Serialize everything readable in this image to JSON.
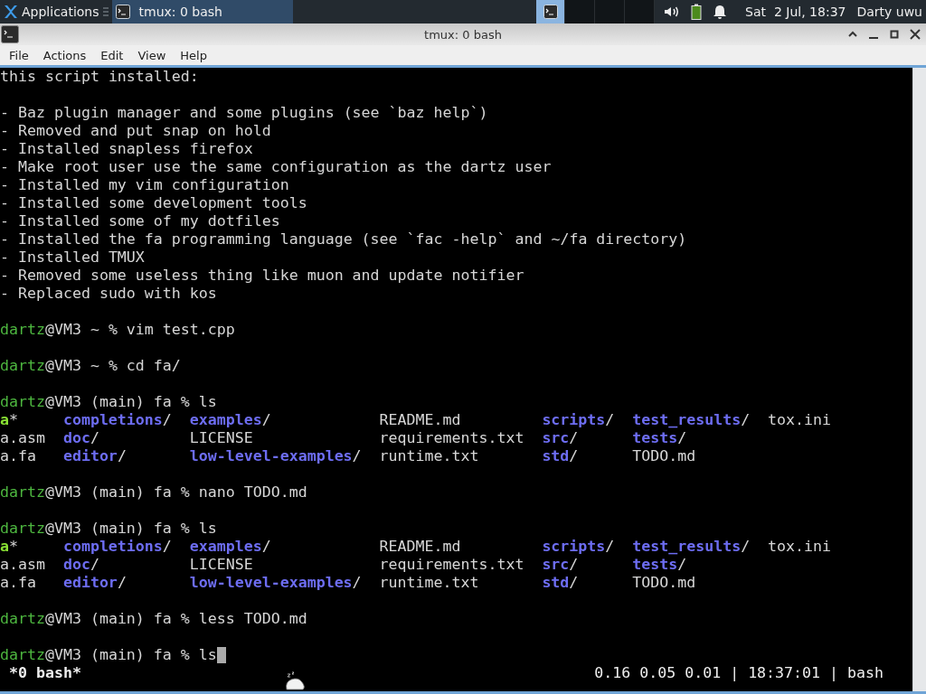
{
  "panel": {
    "menu_label": "Applications",
    "tasks": [
      {
        "title": "tmux: 0 bash",
        "selected": true
      }
    ],
    "workspaces": [
      {
        "selected": true
      },
      {
        "selected": false
      },
      {
        "selected": false
      },
      {
        "selected": false
      }
    ],
    "clock": "Sat  2 Jul, 18:37",
    "user": "Darty uwu"
  },
  "window": {
    "title": "tmux: 0 bash"
  },
  "menubar": [
    "File",
    "Actions",
    "Edit",
    "View",
    "Help"
  ],
  "terminal": {
    "lines": [
      {
        "kind": "text",
        "text": "this script installed:"
      },
      {
        "kind": "blank"
      },
      {
        "kind": "text",
        "text": "- Baz plugin manager and some plugins (see `baz help`)"
      },
      {
        "kind": "text",
        "text": "- Removed and put snap on hold"
      },
      {
        "kind": "text",
        "text": "- Installed snapless firefox"
      },
      {
        "kind": "text",
        "text": "- Make root user use the same configuration as the dartz user"
      },
      {
        "kind": "text",
        "text": "- Installed my vim configuration"
      },
      {
        "kind": "text",
        "text": "- Installed some development tools"
      },
      {
        "kind": "text",
        "text": "- Installed some of my dotfiles"
      },
      {
        "kind": "text",
        "text": "- Installed the fa programming language (see `fac -help` and ~/fa directory)"
      },
      {
        "kind": "text",
        "text": "- Installed TMUX"
      },
      {
        "kind": "text",
        "text": "- Removed some useless thing like muon and update notifier"
      },
      {
        "kind": "text",
        "text": "- Replaced sudo with kos"
      },
      {
        "kind": "blank"
      },
      {
        "kind": "prompt",
        "user": "dartz",
        "rest": "@VM3 ~ % vim test.cpp",
        "cursor": false
      },
      {
        "kind": "blank"
      },
      {
        "kind": "prompt",
        "user": "dartz",
        "rest": "@VM3 ~ % cd fa/",
        "cursor": false
      },
      {
        "kind": "blank"
      },
      {
        "kind": "prompt",
        "user": "dartz",
        "rest": "@VM3 (main) fa % ls",
        "cursor": false
      },
      {
        "kind": "listing",
        "rows": [
          [
            {
              "name": "a",
              "suffix": "*",
              "kind": "exec"
            },
            {
              "name": "completions",
              "suffix": "/",
              "kind": "dir"
            },
            {
              "name": "examples",
              "suffix": "/",
              "kind": "dir"
            },
            {
              "name": "README.md",
              "kind": "file"
            },
            {
              "name": "scripts",
              "suffix": "/",
              "kind": "dir"
            },
            {
              "name": "test_results",
              "suffix": "/",
              "kind": "dir"
            },
            {
              "name": "tox.ini",
              "kind": "file"
            }
          ],
          [
            {
              "name": "a.asm",
              "kind": "file"
            },
            {
              "name": "doc",
              "suffix": "/",
              "kind": "dir"
            },
            {
              "name": "LICENSE",
              "kind": "file"
            },
            {
              "name": "requirements.txt",
              "kind": "file"
            },
            {
              "name": "src",
              "suffix": "/",
              "kind": "dir"
            },
            {
              "name": "tests",
              "suffix": "/",
              "kind": "dir"
            }
          ],
          [
            {
              "name": "a.fa",
              "kind": "file"
            },
            {
              "name": "editor",
              "suffix": "/",
              "kind": "dir"
            },
            {
              "name": "low-level-examples",
              "suffix": "/",
              "kind": "dir"
            },
            {
              "name": "runtime.txt",
              "kind": "file"
            },
            {
              "name": "std",
              "suffix": "/",
              "kind": "dir"
            },
            {
              "name": "TODO.md",
              "kind": "file"
            }
          ]
        ]
      },
      {
        "kind": "blank"
      },
      {
        "kind": "prompt",
        "user": "dartz",
        "rest": "@VM3 (main) fa % nano TODO.md",
        "cursor": false
      },
      {
        "kind": "blank"
      },
      {
        "kind": "prompt",
        "user": "dartz",
        "rest": "@VM3 (main) fa % ls",
        "cursor": false
      },
      {
        "kind": "listing",
        "rows": [
          [
            {
              "name": "a",
              "suffix": "*",
              "kind": "exec"
            },
            {
              "name": "completions",
              "suffix": "/",
              "kind": "dir"
            },
            {
              "name": "examples",
              "suffix": "/",
              "kind": "dir"
            },
            {
              "name": "README.md",
              "kind": "file"
            },
            {
              "name": "scripts",
              "suffix": "/",
              "kind": "dir"
            },
            {
              "name": "test_results",
              "suffix": "/",
              "kind": "dir"
            },
            {
              "name": "tox.ini",
              "kind": "file"
            }
          ],
          [
            {
              "name": "a.asm",
              "kind": "file"
            },
            {
              "name": "doc",
              "suffix": "/",
              "kind": "dir"
            },
            {
              "name": "LICENSE",
              "kind": "file"
            },
            {
              "name": "requirements.txt",
              "kind": "file"
            },
            {
              "name": "src",
              "suffix": "/",
              "kind": "dir"
            },
            {
              "name": "tests",
              "suffix": "/",
              "kind": "dir"
            }
          ],
          [
            {
              "name": "a.fa",
              "kind": "file"
            },
            {
              "name": "editor",
              "suffix": "/",
              "kind": "dir"
            },
            {
              "name": "low-level-examples",
              "suffix": "/",
              "kind": "dir"
            },
            {
              "name": "runtime.txt",
              "kind": "file"
            },
            {
              "name": "std",
              "suffix": "/",
              "kind": "dir"
            },
            {
              "name": "TODO.md",
              "kind": "file"
            }
          ]
        ]
      },
      {
        "kind": "blank"
      },
      {
        "kind": "prompt",
        "user": "dartz",
        "rest": "@VM3 (main) fa % less TODO.md",
        "cursor": false
      },
      {
        "kind": "blank"
      },
      {
        "kind": "prompt",
        "user": "dartz",
        "rest": "@VM3 (main) fa % ls",
        "cursor": true
      }
    ],
    "status": {
      "window": "*0 bash*",
      "info": "0.16 0.05 0.01 | 18:37:01 | bash"
    }
  }
}
